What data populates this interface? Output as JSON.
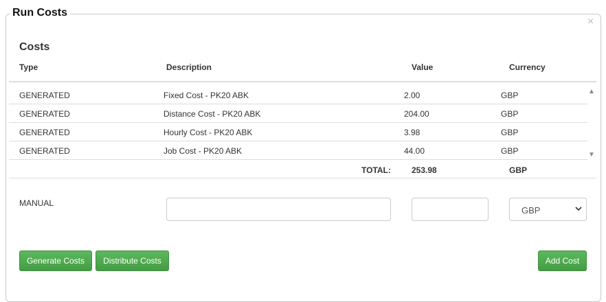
{
  "panel": {
    "title": "Run Costs",
    "close_glyph": "×"
  },
  "section": {
    "title": "Costs"
  },
  "table": {
    "headers": {
      "type": "Type",
      "description": "Description",
      "value": "Value",
      "currency": "Currency"
    },
    "rows": [
      {
        "type": "GENERATED",
        "description": "Fixed Cost - PK20 ABK",
        "value": "2.00",
        "currency": "GBP"
      },
      {
        "type": "GENERATED",
        "description": "Distance Cost - PK20 ABK",
        "value": "204.00",
        "currency": "GBP"
      },
      {
        "type": "GENERATED",
        "description": "Hourly Cost - PK20 ABK",
        "value": "3.98",
        "currency": "GBP"
      },
      {
        "type": "GENERATED",
        "description": "Job Cost - PK20 ABK",
        "value": "44.00",
        "currency": "GBP"
      }
    ],
    "total": {
      "label": "TOTAL:",
      "value": "253.98",
      "currency": "GBP"
    }
  },
  "manual_entry": {
    "label": "MANUAL",
    "description_value": "",
    "value_value": "",
    "currency_selected": "GBP"
  },
  "buttons": {
    "generate": "Generate Costs",
    "distribute": "Distribute Costs",
    "add": "Add Cost"
  },
  "icons": {
    "close": "close-icon",
    "scroll_up": "scroll-up-arrow-icon",
    "scroll_down": "scroll-down-arrow-icon",
    "select": "chevron-down-icon"
  },
  "colors": {
    "button_green": "#5cb85c",
    "border": "#dddddd",
    "text": "#333333"
  }
}
